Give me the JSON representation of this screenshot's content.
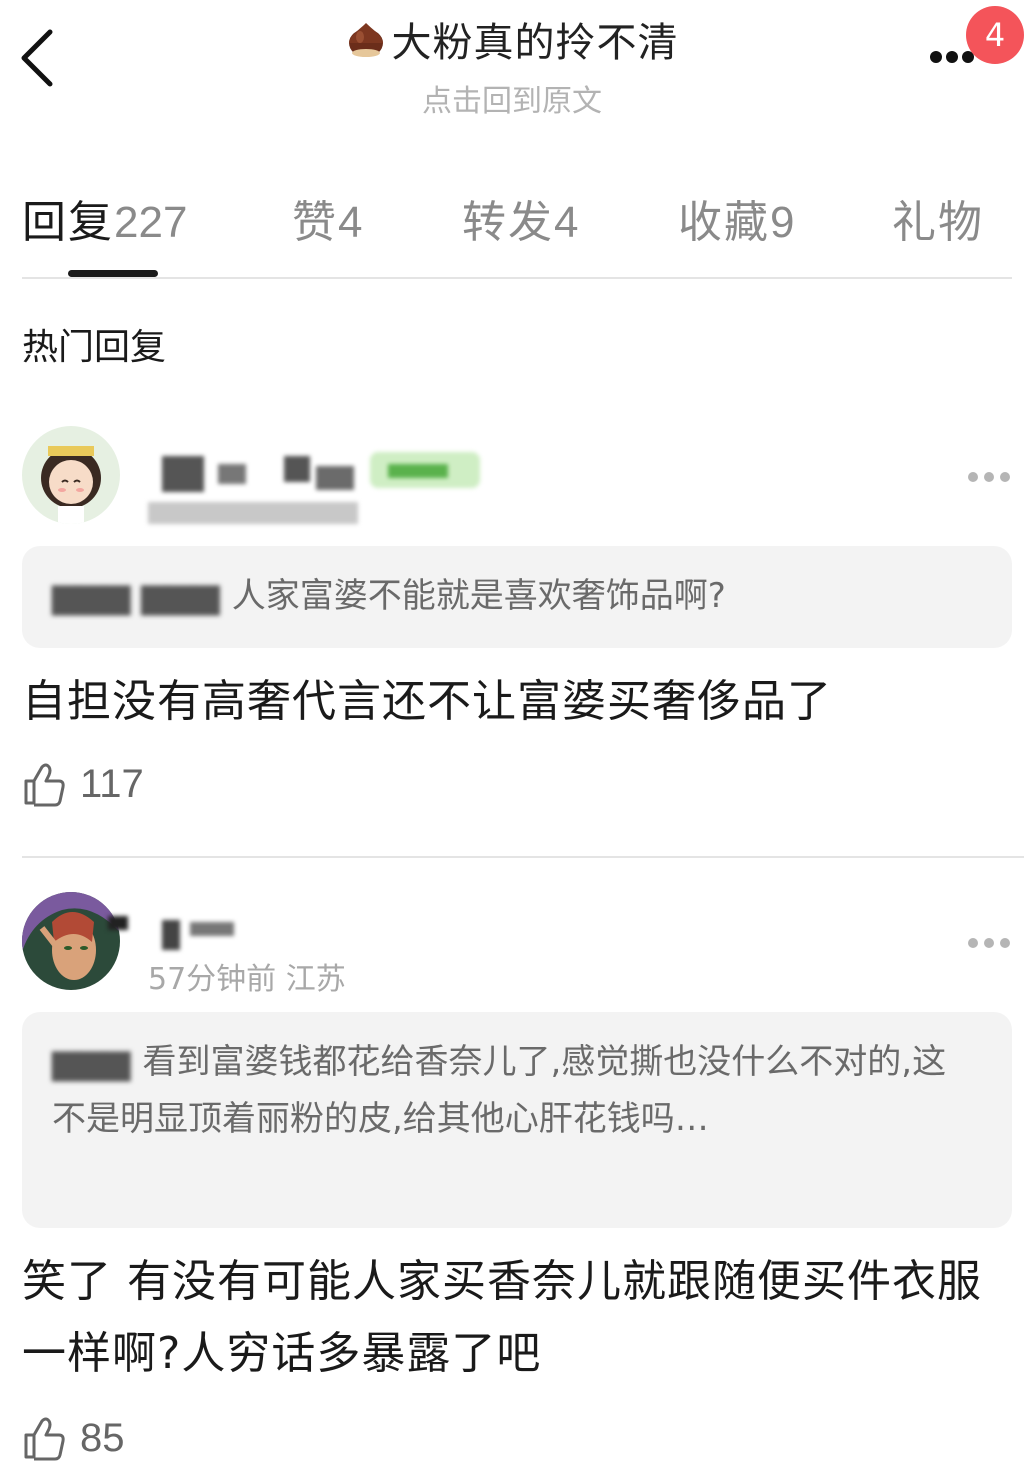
{
  "header": {
    "title": "大粉真的拎不清",
    "subtitle": "点击回到原文",
    "notification_count": "4"
  },
  "tabs": [
    {
      "label": "回复",
      "count": "227"
    },
    {
      "label": "赞",
      "count": "4"
    },
    {
      "label": "转发",
      "count": "4"
    },
    {
      "label": "收藏",
      "count": "9"
    },
    {
      "label": "礼物",
      "count": ""
    }
  ],
  "section_title": "热门回复",
  "comments": [
    {
      "meta": "",
      "quote": "人家富婆不能就是喜欢奢饰品啊?",
      "body": "自担没有高奢代言还不让富婆买奢侈品了",
      "likes": "117"
    },
    {
      "meta": "57分钟前 江苏",
      "quote": "看到富婆钱都花给香奈儿了,感觉撕也没什么不对的,这不是明显顶着丽粉的皮,给其他心肝花钱吗…",
      "body": "笑了  有没有可能人家买香奈儿就跟随便买件衣服一样啊?人穷话多暴露了吧",
      "likes": "85"
    }
  ],
  "colors": {
    "badge": "#f4545a",
    "muted_text": "#a8a8a8",
    "quote_bg": "#f3f3f3"
  }
}
